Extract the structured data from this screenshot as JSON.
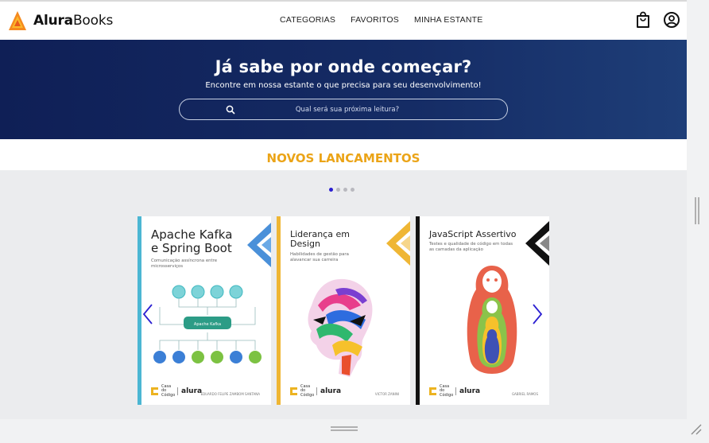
{
  "header": {
    "logo_bold": "Alura",
    "logo_rest": "Books",
    "nav": [
      "CATEGORIAS",
      "FAVORITOS",
      "MINHA ESTANTE"
    ],
    "icons": [
      "shopping-bag-icon",
      "user-profile-icon"
    ]
  },
  "banner": {
    "title": "Já sabe por onde começar?",
    "subtitle": "Encontre em nossa estante o que precisa para seu desenvolvimento!",
    "search_placeholder": "Qual será sua próxima leitura?"
  },
  "section": {
    "title": "NOVOS LANCAMENTOS",
    "pagination": {
      "total": 4,
      "active": 1
    }
  },
  "books": [
    {
      "title_lines": [
        "Apache Kafka",
        "e Spring Boot"
      ],
      "subtitle": "Comunicação assíncrona entre microsserviços",
      "author": "EDUARDO FELIPE ZAMBOM SANTANA",
      "publisher": "Casa do Código",
      "brand": "alura",
      "accent": "#4bb6d3"
    },
    {
      "title_lines": [
        "Liderança em",
        "Design"
      ],
      "subtitle": "Habilidades de gestão para alavancar sua carreira",
      "author": "VICTOR ZANINI",
      "publisher": "Casa do Código",
      "brand": "alura",
      "accent": "#efb634"
    },
    {
      "title_lines": [
        "JavaScript Assertivo"
      ],
      "subtitle": "Testes e qualidade de código em todas as camadas da aplicação",
      "author": "GABRIEL RAMOS",
      "publisher": "Casa do Código",
      "brand": "alura",
      "accent": "#111111"
    }
  ],
  "colors": {
    "banner_start": "#0f1f56",
    "banner_end": "#1e3e78",
    "section_title": "#eba417",
    "dot_active": "#2a1ed1",
    "arrow": "#2a1ed1"
  }
}
